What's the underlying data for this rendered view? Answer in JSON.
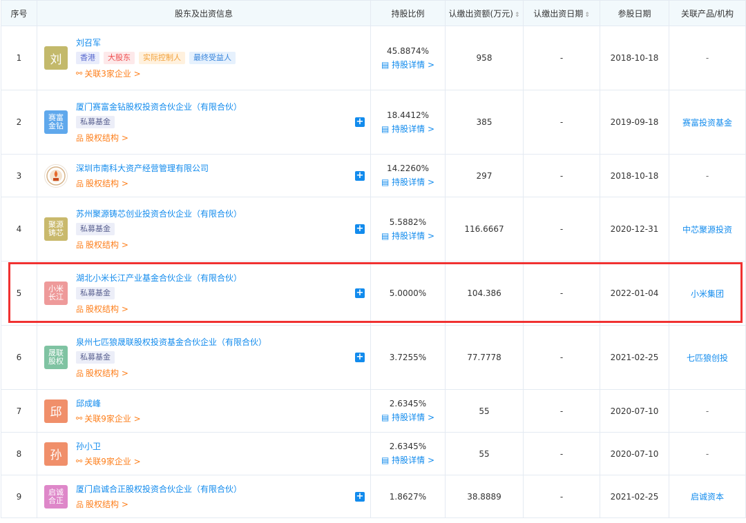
{
  "header": {
    "idx": "序号",
    "holder": "股东及出资信息",
    "pct": "持股比例",
    "amount": "认缴出资额(万元)",
    "due": "认缴出资日期",
    "date": "参股日期",
    "product": "关联产品/机构",
    "sort_glyph": "⇕"
  },
  "rows": [
    {
      "idx": "1",
      "logo": "刘",
      "name": "刘召军",
      "tags": [
        "香港",
        "大股东",
        "实际控制人",
        "最终受益人"
      ],
      "link": "关联3家企业 >",
      "pct": "45.8874%",
      "pct_link": "持股详情 >",
      "amount": "958",
      "due": "-",
      "date": "2018-10-18",
      "product": "-"
    },
    {
      "idx": "2",
      "logo": "赛富金钻",
      "name": "厦门赛富金钻股权投资合伙企业（有限合伙）",
      "tags": [
        "私募基金"
      ],
      "link": "股权结构 >",
      "pct": "18.4412%",
      "pct_link": "持股详情 >",
      "amount": "385",
      "due": "-",
      "date": "2019-09-18",
      "product": "赛富投资基金"
    },
    {
      "idx": "3",
      "logo": "",
      "name": "深圳市南科大资产经营管理有限公司",
      "tags": [],
      "link": "股权结构 >",
      "pct": "14.2260%",
      "pct_link": "持股详情 >",
      "amount": "297",
      "due": "-",
      "date": "2018-10-18",
      "product": "-"
    },
    {
      "idx": "4",
      "logo": "聚源铸芯",
      "name": "苏州聚源铸芯创业投资合伙企业（有限合伙）",
      "tags": [
        "私募基金"
      ],
      "link": "股权结构 >",
      "pct": "5.5882%",
      "pct_link": "持股详情 >",
      "amount": "116.6667",
      "due": "-",
      "date": "2020-12-31",
      "product": "中芯聚源投资"
    },
    {
      "idx": "5",
      "logo": "小米长江",
      "name": "湖北小米长江产业基金合伙企业（有限合伙）",
      "tags": [
        "私募基金"
      ],
      "link": "股权结构 >",
      "pct": "5.0000%",
      "pct_link": "",
      "amount": "104.386",
      "due": "-",
      "date": "2022-01-04",
      "product": "小米集团"
    },
    {
      "idx": "6",
      "logo": "晟联股权",
      "name": "泉州七匹狼晟联股权投资基金合伙企业（有限合伙）",
      "tags": [
        "私募基金"
      ],
      "link": "股权结构 >",
      "pct": "3.7255%",
      "pct_link": "",
      "amount": "77.7778",
      "due": "-",
      "date": "2021-02-25",
      "product": "七匹狼创投"
    },
    {
      "idx": "7",
      "logo": "邱",
      "name": "邱成峰",
      "tags": [],
      "link": "关联9家企业 >",
      "pct": "2.6345%",
      "pct_link": "持股详情 >",
      "amount": "55",
      "due": "-",
      "date": "2020-07-10",
      "product": "-"
    },
    {
      "idx": "8",
      "logo": "孙",
      "name": "孙小卫",
      "tags": [],
      "link": "关联9家企业 >",
      "pct": "2.6345%",
      "pct_link": "持股详情 >",
      "amount": "55",
      "due": "-",
      "date": "2020-07-10",
      "product": "-"
    },
    {
      "idx": "9",
      "logo": "启诚合正",
      "name": "厦门启诚合正股权投资合伙企业（有限合伙）",
      "tags": [],
      "link": "股权结构 >",
      "pct": "1.8627%",
      "pct_link": "",
      "amount": "38.8889",
      "due": "-",
      "date": "2021-02-25",
      "product": "启诚资本"
    }
  ],
  "colors": {
    "accent": "#128bed",
    "orange": "#fd7e1a",
    "highlight": "#f03131",
    "header_bg": "#f2f9fc",
    "logo_1": "#c3b96b",
    "logo_2": "#5fa8ec",
    "logo_4": "#c9b96c",
    "logo_5": "#ee9a9a",
    "logo_6": "#7fc3a2",
    "logo_7": "#f08f6a",
    "logo_8": "#f08f6a",
    "logo_9": "#de87c9"
  },
  "icons": {
    "link_related": "network-icon",
    "link_structure": "org-structure-icon",
    "pct_link": "detail-doc-icon",
    "expand": "plus-icon"
  }
}
